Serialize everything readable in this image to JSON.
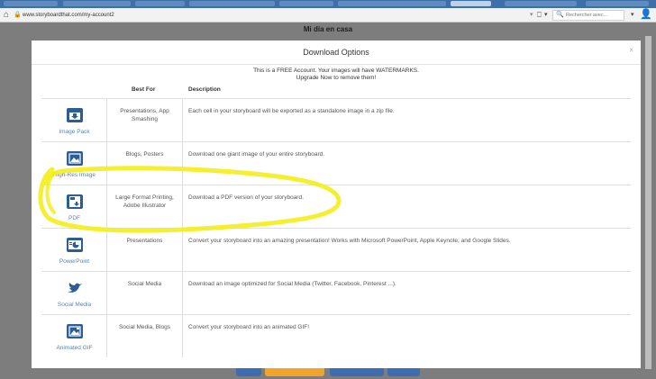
{
  "browser": {
    "url": "www.storyboardthat.com/my-account2",
    "search_placeholder": "Rechercher avec..."
  },
  "page": {
    "title": "Mi dia en casa"
  },
  "modal": {
    "title": "Download Options",
    "close": "×",
    "notice_line1": "This is a FREE Account. Your images will have WATERMARKS.",
    "notice_line2": "Upgrade Now to remove them!",
    "col_best_for": "Best For",
    "col_description": "Description",
    "options": [
      {
        "label": "Image Pack",
        "icon": "image-pack-icon",
        "best_for": "Presentations, App Smashing",
        "description": "Each cell in your storyboard will be exported as a standalone image in a zip file."
      },
      {
        "label": "High-Res Image",
        "icon": "high-res-image-icon",
        "best_for": "Blogs, Posters",
        "description": "Download one giant image of your entire storyboard."
      },
      {
        "label": "PDF",
        "icon": "pdf-icon",
        "best_for": "Large Format Printing, Adobe Illustrator",
        "description": "Download a PDF version of your storyboard."
      },
      {
        "label": "PowerPoint",
        "icon": "powerpoint-icon",
        "best_for": "Presentations",
        "description": "Convert your storyboard into an amazing presentation! Works with Microsoft PowerPoint, Apple Keynote, and Google Slides."
      },
      {
        "label": "Social Media",
        "icon": "twitter-bird-icon",
        "best_for": "Social Media",
        "description": "Download an image optimized for Social Media (Twitter, Facebook, Pinterest ...)."
      },
      {
        "label": "Animated GIF",
        "icon": "animated-gif-icon",
        "best_for": "Social Media, Blogs",
        "description": "Convert your storyboard into an animated GIF!"
      }
    ]
  },
  "colors": {
    "accent_blue": "#2c5d93",
    "link_blue": "#4f88be",
    "highlight_yellow": "#f3ef1e",
    "overlay_gray": "#7d7d7d"
  }
}
